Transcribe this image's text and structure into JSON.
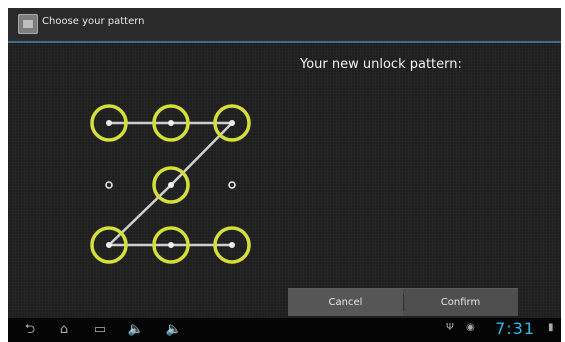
{
  "app": {
    "title": "Choose your pattern",
    "icon": "settings-app-icon"
  },
  "instruction": "Your new unlock pattern:",
  "pattern": {
    "dot_count": 9,
    "sequence": [
      1,
      2,
      3,
      5,
      7,
      8,
      9
    ],
    "accent_color": "#d6df3a"
  },
  "buttons": {
    "cancel_label": "Cancel",
    "confirm_label": "Confirm"
  },
  "navbar": {
    "icons": [
      "back-icon",
      "home-icon",
      "recent-apps-icon",
      "volume-down-icon",
      "volume-up-icon"
    ]
  },
  "status": {
    "time": "7:31",
    "icons": [
      "usb-icon",
      "sync-icon",
      "battery-icon"
    ]
  }
}
